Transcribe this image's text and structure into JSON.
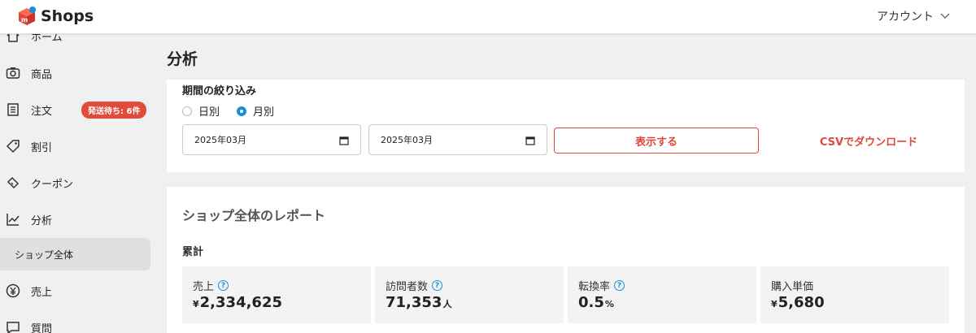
{
  "header": {
    "brand": "Shops",
    "account_label": "アカウント",
    "brand_color": "#e0493a"
  },
  "sidebar": {
    "items": [
      {
        "label": "ホーム",
        "icon": "home-icon"
      },
      {
        "label": "商品",
        "icon": "camera-icon"
      },
      {
        "label": "注文",
        "icon": "receipt-icon",
        "badge": "発送待ち: 6件"
      },
      {
        "label": "割引",
        "icon": "tag-icon"
      },
      {
        "label": "クーポン",
        "icon": "ticket-icon"
      },
      {
        "label": "分析",
        "icon": "chart-icon"
      },
      {
        "label": "ショップ全体",
        "icon": ""
      },
      {
        "label": "売上",
        "icon": "yen-icon"
      },
      {
        "label": "質問",
        "icon": "chat-icon"
      }
    ]
  },
  "main": {
    "page_title": "分析",
    "filter": {
      "title": "期間の絞り込み",
      "radio_daily": "日別",
      "radio_monthly": "月別",
      "selected": "月別",
      "start_date": "2025年03月",
      "end_date": "2025年03月",
      "show_button": "表示する",
      "csv_button": "CSVでダウンロード"
    },
    "report": {
      "title": "ショップ全体のレポート",
      "cumulative_label": "累計",
      "stats": [
        {
          "label": "売上",
          "help": "?",
          "prefix": "¥",
          "value": "2,334,625",
          "suffix": ""
        },
        {
          "label": "訪問者数",
          "help": "?",
          "prefix": "",
          "value": "71,353",
          "suffix": "人"
        },
        {
          "label": "転換率",
          "help": "?",
          "prefix": "",
          "value": "0.5",
          "suffix": "%"
        },
        {
          "label": "購入単価",
          "help": "",
          "prefix": "¥",
          "value": "5,680",
          "suffix": ""
        }
      ]
    }
  },
  "colors": {
    "accent": "#e0493a",
    "radio_selected": "#1a8fd8"
  }
}
